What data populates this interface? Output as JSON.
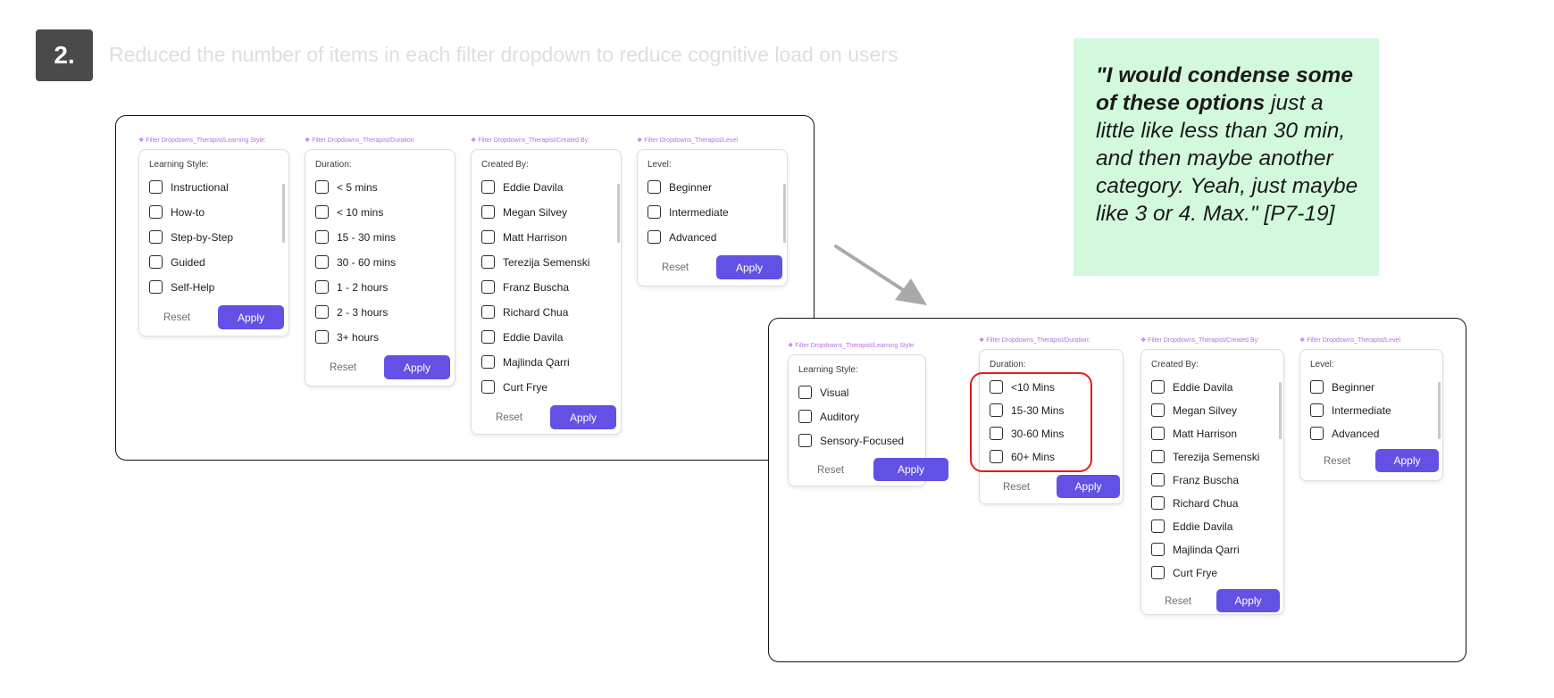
{
  "step": {
    "number": "2.",
    "title": "Reduced the number of items in each filter dropdown to reduce cognitive load on users"
  },
  "quote": {
    "bold": "\"I would condense some of these options",
    "rest": " just a little like less than 30 min, and then maybe another category. Yeah, just maybe like 3 or 4. Max.\" [P7-19]"
  },
  "before": {
    "learning_style": {
      "annotation": "❖ Filter Dropdowns_Therapist/Learning Style:",
      "label": "Learning Style:",
      "options": [
        "Instructional",
        "How-to",
        "Step-by-Step",
        "Guided",
        "Self-Help"
      ],
      "reset": "Reset",
      "apply": "Apply"
    },
    "duration": {
      "annotation": "❖ Filter Dropdowns_Therapist/Duration",
      "label": "Duration:",
      "options": [
        "< 5 mins",
        "< 10 mins",
        "15 - 30 mins",
        "30 - 60 mins",
        "1 - 2 hours",
        "2 - 3 hours",
        "3+ hours"
      ],
      "reset": "Reset",
      "apply": "Apply"
    },
    "created_by": {
      "annotation": "❖ Filter Dropdowns_Therapist/Created By:",
      "label": "Created By:",
      "options": [
        "Eddie Davila",
        "Megan Silvey",
        "Matt Harrison",
        "Terezija Semenski",
        "Franz Buscha",
        "Richard Chua",
        "Eddie Davila",
        "Majlinda Qarri",
        "Curt Frye"
      ],
      "reset": "Reset",
      "apply": "Apply"
    },
    "level": {
      "annotation": "❖ Filter Dropdowns_Therapist/Level",
      "label": "Level:",
      "options": [
        "Beginner",
        "Intermediate",
        "Advanced"
      ],
      "reset": "Reset",
      "apply": "Apply"
    }
  },
  "after": {
    "learning_style": {
      "annotation": "❖ Filter Dropdowns_Therapist/Learning Style:",
      "label": "Learning Style:",
      "options": [
        "Visual",
        "Auditory",
        "Sensory-Focused"
      ],
      "reset": "Reset",
      "apply": "Apply"
    },
    "duration": {
      "annotation": "❖ Filter Dropdowns_Therapist/Duration:",
      "label": "Duration:",
      "options": [
        "<10 Mins",
        "15-30 Mins",
        "30-60 Mins",
        "60+ Mins"
      ],
      "reset": "Reset",
      "apply": "Apply"
    },
    "created_by": {
      "annotation": "❖ Filter Dropdowns_Therapist/Created By:",
      "label": "Created By:",
      "options": [
        "Eddie Davila",
        "Megan Silvey",
        "Matt Harrison",
        "Terezija Semenski",
        "Franz Buscha",
        "Richard Chua",
        "Eddie Davila",
        "Majlinda Qarri",
        "Curt Frye"
      ],
      "reset": "Reset",
      "apply": "Apply"
    },
    "level": {
      "annotation": "❖ Filter Dropdowns_Therapist/Level",
      "label": "Level:",
      "options": [
        "Beginner",
        "Intermediate",
        "Advanced"
      ],
      "reset": "Reset",
      "apply": "Apply"
    }
  },
  "colors": {
    "accent": "#6251e4",
    "highlight": "#e51b1b",
    "quote_bg": "#d3f9dd",
    "annotation": "#b76ee8"
  }
}
